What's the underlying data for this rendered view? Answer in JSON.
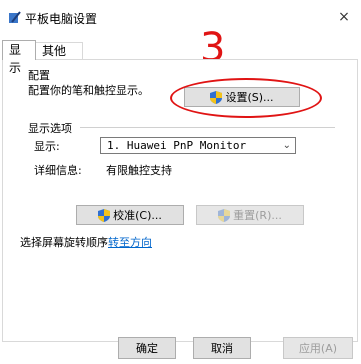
{
  "window": {
    "title": "平板电脑设置",
    "close": "×"
  },
  "tabs": [
    {
      "label": "显示"
    },
    {
      "label": "其他"
    }
  ],
  "config": {
    "heading": "配置",
    "description": "配置你的笔和触控显示。",
    "setup_button": "设置(S)..."
  },
  "display_options": {
    "heading": "显示选项",
    "display_label": "显示:",
    "display_value": "1. Huawei PnP Monitor",
    "details_label": "详细信息:",
    "details_value": "有限触控支持",
    "calibrate_button": "校准(C)...",
    "reset_button": "重置(R)..."
  },
  "rotation": {
    "prefix": "选择屏幕旋转顺序",
    "link": "转至方向"
  },
  "annotation": {
    "number": "3",
    "color": "#e01414"
  },
  "footer": {
    "ok": "确定",
    "cancel": "取消",
    "apply": "应用(A)"
  }
}
